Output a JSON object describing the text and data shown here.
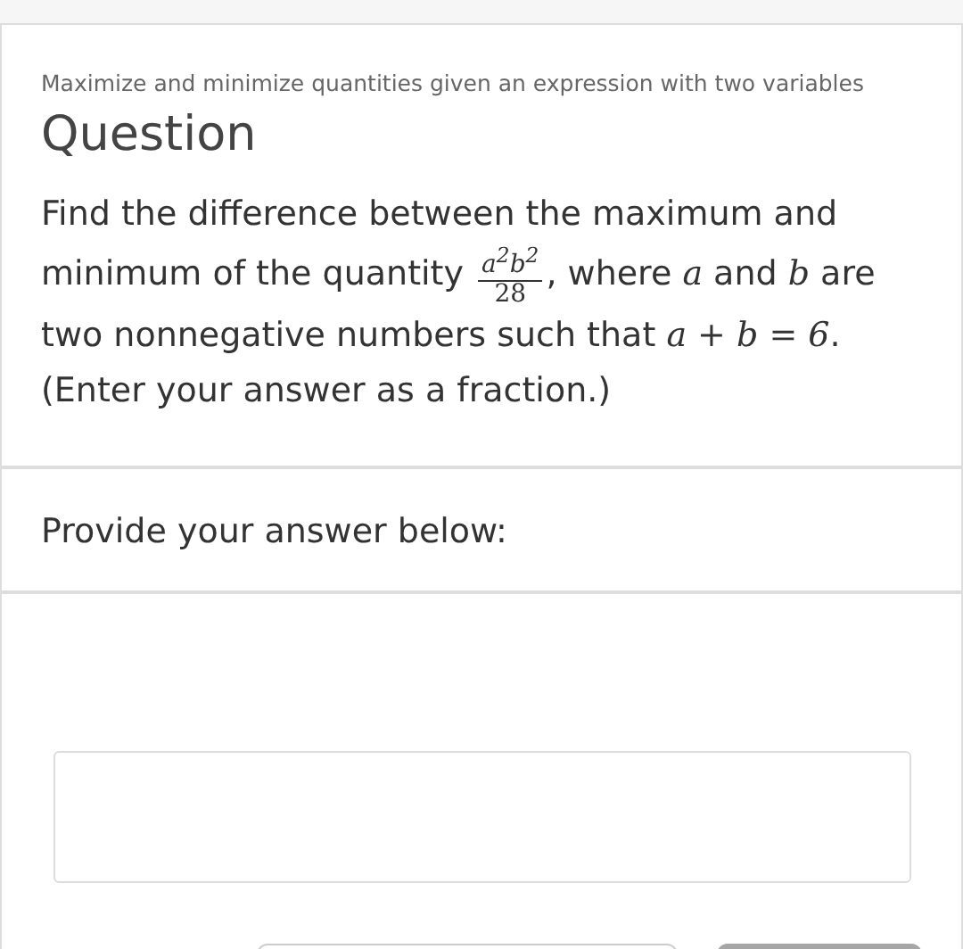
{
  "subtitle": "Maximize and minimize quantities given an expression with two variables",
  "heading": "Question",
  "prompt": [
    {
      "kind": "text",
      "text": "Find the difference between the maximum and minimum of the quantity "
    },
    {
      "kind": "fraction",
      "numerator": "a$^{2}$b$^{2}$",
      "denominator": "28"
    },
    {
      "kind": "text",
      "text": ", where "
    },
    {
      "kind": "math",
      "text": "a"
    },
    {
      "kind": "text",
      "text": " and "
    },
    {
      "kind": "math",
      "text": "b"
    },
    {
      "kind": "text",
      "text": " are two nonnegative numbers such that "
    },
    {
      "kind": "math",
      "text": "a + b = 6"
    },
    {
      "kind": "text",
      "text": ". (Enter your answer as a fraction.)"
    }
  ],
  "answer_label": "Provide your answer below:",
  "buttons": [
    {
      "kind": "outline"
    },
    {
      "kind": "filled"
    }
  ]
}
